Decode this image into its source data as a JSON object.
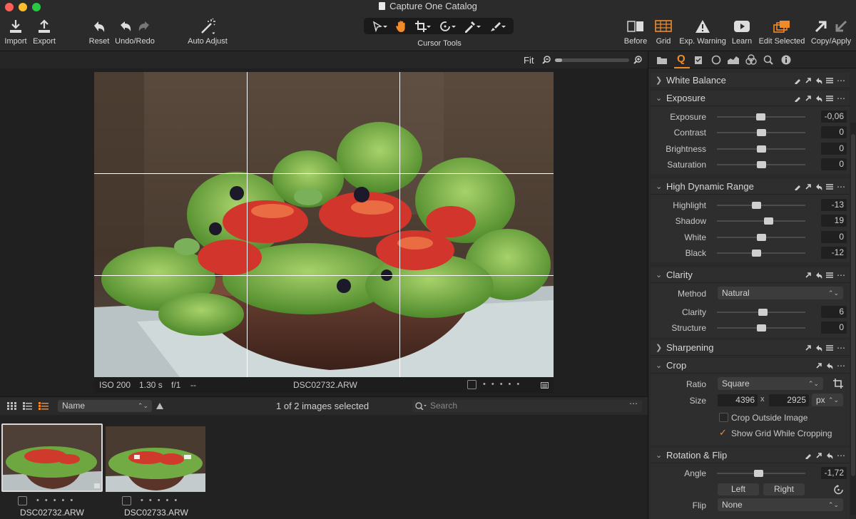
{
  "window": {
    "title": "Capture One Catalog"
  },
  "toolbar": {
    "import": "Import",
    "export": "Export",
    "reset": "Reset",
    "undo_redo": "Undo/Redo",
    "auto_adjust": "Auto Adjust",
    "cursor_tools": "Cursor Tools",
    "before": "Before",
    "grid": "Grid",
    "exp_warning": "Exp. Warning",
    "learn": "Learn",
    "edit_selected": "Edit Selected",
    "copy_apply": "Copy/Apply"
  },
  "viewer": {
    "zoom_label": "Fit",
    "zoom_level": 0.1
  },
  "image_info": {
    "iso": "ISO 200",
    "shutter": "1.30 s",
    "aperture": "f/1",
    "extra": "--",
    "filename": "DSC02732.ARW"
  },
  "browser": {
    "sort_by": "Name",
    "selection_status": "1 of 2 images selected",
    "search_placeholder": "Search"
  },
  "thumbnails": [
    {
      "filename": "DSC02732.ARW",
      "selected": true
    },
    {
      "filename": "DSC02733.ARW",
      "selected": false
    }
  ],
  "panel": {
    "white_balance": {
      "title": "White Balance"
    },
    "exposure": {
      "title": "Exposure",
      "rows": [
        {
          "label": "Exposure",
          "value": "-0,06",
          "pos": 0.49
        },
        {
          "label": "Contrast",
          "value": "0",
          "pos": 0.5
        },
        {
          "label": "Brightness",
          "value": "0",
          "pos": 0.5
        },
        {
          "label": "Saturation",
          "value": "0",
          "pos": 0.5
        }
      ]
    },
    "hdr": {
      "title": "High Dynamic Range",
      "rows": [
        {
          "label": "Highlight",
          "value": "-13",
          "pos": 0.44
        },
        {
          "label": "Shadow",
          "value": "19",
          "pos": 0.58
        },
        {
          "label": "White",
          "value": "0",
          "pos": 0.5
        },
        {
          "label": "Black",
          "value": "-12",
          "pos": 0.44
        }
      ]
    },
    "clarity": {
      "title": "Clarity",
      "method_label": "Method",
      "method_value": "Natural",
      "rows": [
        {
          "label": "Clarity",
          "value": "6",
          "pos": 0.52
        },
        {
          "label": "Structure",
          "value": "0",
          "pos": 0.5
        }
      ]
    },
    "sharpening": {
      "title": "Sharpening"
    },
    "crop": {
      "title": "Crop",
      "ratio_label": "Ratio",
      "ratio_value": "Square",
      "size_label": "Size",
      "width": "4396",
      "x": "x",
      "height": "2925",
      "unit": "px",
      "crop_outside_label": "Crop Outside Image",
      "crop_outside_checked": false,
      "show_grid_label": "Show Grid While Cropping",
      "show_grid_checked": true
    },
    "rotation": {
      "title": "Rotation & Flip",
      "angle_label": "Angle",
      "angle_value": "-1,72",
      "angle_pos": 0.47,
      "left_label": "Left",
      "right_label": "Right",
      "flip_label": "Flip",
      "flip_value": "None"
    }
  }
}
